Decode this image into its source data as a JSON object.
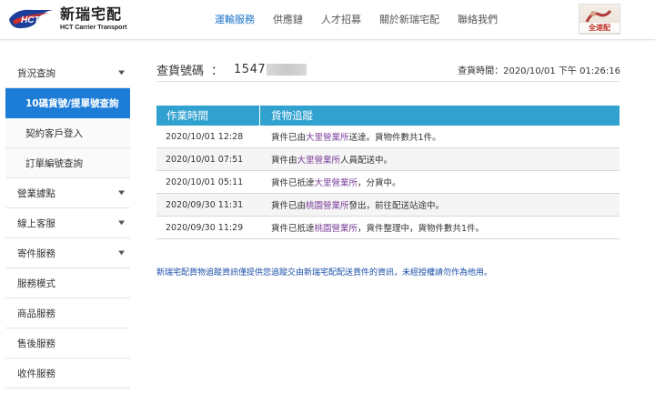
{
  "header": {
    "logo_cn": "新瑞宅配",
    "logo_en": "HCT Carrier Transport",
    "logo_mark": "HCT",
    "nav": [
      "運輸服務",
      "供應鏈",
      "人才招募",
      "關於新瑞宅配",
      "聯絡我們"
    ],
    "partner_label": "全速配"
  },
  "sidebar": {
    "items": [
      {
        "label": "貨況查詢",
        "has_chevron": true
      },
      {
        "label": "10碼貨號/提單號查詢",
        "sub": true,
        "active": true
      },
      {
        "label": "契約客戶登入",
        "sub": true
      },
      {
        "label": "訂單編號查詢",
        "sub": true
      },
      {
        "label": "營業據點",
        "has_chevron": true
      },
      {
        "label": "線上客服",
        "has_chevron": true
      },
      {
        "label": "寄件服務",
        "has_chevron": true
      },
      {
        "label": "服務模式"
      },
      {
        "label": "商品服務"
      },
      {
        "label": "售後服務"
      },
      {
        "label": "收件服務"
      }
    ]
  },
  "query": {
    "label": "查貨號碼",
    "separator": "：",
    "number": "1547",
    "time_label": "查貨時間：",
    "time_value": "2020/10/01 下午 01:26:16"
  },
  "table": {
    "headers": [
      "作業時間",
      "貨物追蹤"
    ],
    "rows": [
      {
        "time": "2020/10/01 12:28",
        "pre": "貨件已由",
        "loc": "大里營業所",
        "post": "送達。貨物件數共1件。"
      },
      {
        "time": "2020/10/01 07:51",
        "pre": "貨件由",
        "loc": "大里營業所",
        "post": "人員配送中。"
      },
      {
        "time": "2020/10/01 05:11",
        "pre": "貨件已抵達",
        "loc": "大里營業所",
        "post": "，分貨中。"
      },
      {
        "time": "2020/09/30 11:31",
        "pre": "貨件已由",
        "loc": "桃園營業所",
        "post": "發出，前往配送站途中。"
      },
      {
        "time": "2020/09/30 11:29",
        "pre": "貨件已抵達",
        "loc": "桃園營業所",
        "post": "，貨件整理中，貨物件數共1件。"
      }
    ]
  },
  "footnote": "新瑞宅配貨物追蹤資訊僅提供您追蹤交由新瑞宅配配送貨件的資訊，未經授權請勿作為他用。",
  "colors": {
    "accent": "#1c7cd6",
    "table_header": "#31a2d0",
    "location": "#7b3f99",
    "footnote": "#1a4fa8"
  }
}
